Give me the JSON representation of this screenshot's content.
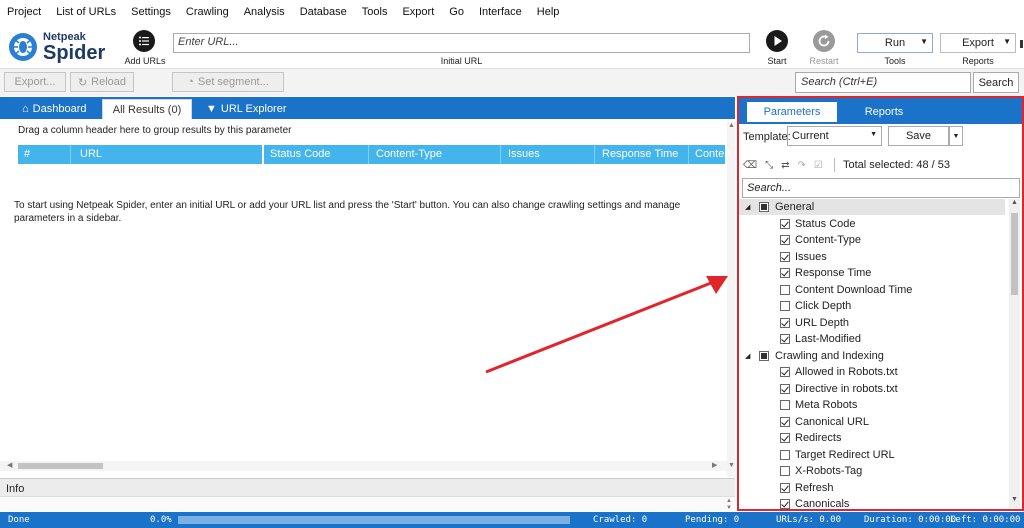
{
  "menu": [
    "Project",
    "List of URLs",
    "Settings",
    "Crawling",
    "Analysis",
    "Database",
    "Tools",
    "Export",
    "Go",
    "Interface",
    "Help"
  ],
  "logo": {
    "line1": "Netpeak",
    "line2": "Spider"
  },
  "toolbar": {
    "add_urls_label": "Add URLs",
    "url_placeholder": "Enter URL...",
    "initial_url_label": "Initial URL",
    "start_label": "Start",
    "restart_label": "Restart",
    "run_label": "Run",
    "tools_label": "Tools",
    "export_label": "Export",
    "reports_label": "Reports"
  },
  "secondrow": {
    "export_label": "Export...",
    "reload_label": "Reload",
    "segment_label": "Set segment...",
    "search_placeholder": "Search (Ctrl+E)",
    "search_button": "Search"
  },
  "tabs": {
    "dashboard": "Dashboard",
    "all_results": "All Results (0)",
    "url_explorer": "URL Explorer"
  },
  "grid": {
    "group_hint": "Drag a column header here to group results by this parameter",
    "columns": [
      "#",
      "URL",
      "Status Code",
      "Content-Type",
      "Issues",
      "Response Time",
      "Conten"
    ],
    "empty_message": "To start using Netpeak Spider, enter an initial URL or add your URL list and press the 'Start' button. You can also change crawling settings and manage parameters in a sidebar."
  },
  "info_label": "Info",
  "panel": {
    "tab_parameters": "Parameters",
    "tab_reports": "Reports",
    "template_label": "Template:",
    "template_value": "Current",
    "save_label": "Save",
    "total_selected": "Total selected: 48 / 53",
    "search_placeholder": "Search...",
    "groups": [
      {
        "name": "General",
        "items": [
          {
            "label": "Status Code",
            "checked": true
          },
          {
            "label": "Content-Type",
            "checked": true
          },
          {
            "label": "Issues",
            "checked": true
          },
          {
            "label": "Response Time",
            "checked": true
          },
          {
            "label": "Content Download Time",
            "checked": false
          },
          {
            "label": "Click Depth",
            "checked": false
          },
          {
            "label": "URL Depth",
            "checked": true
          },
          {
            "label": "Last-Modified",
            "checked": true
          }
        ]
      },
      {
        "name": "Crawling and Indexing",
        "items": [
          {
            "label": "Allowed in Robots.txt",
            "checked": true
          },
          {
            "label": "Directive in robots.txt",
            "checked": true
          },
          {
            "label": "Meta Robots",
            "checked": false
          },
          {
            "label": "Canonical URL",
            "checked": true
          },
          {
            "label": "Redirects",
            "checked": true
          },
          {
            "label": "Target Redirect URL",
            "checked": false
          },
          {
            "label": "X-Robots-Tag",
            "checked": false
          },
          {
            "label": "Refresh",
            "checked": true
          },
          {
            "label": "Canonicals",
            "checked": true
          }
        ]
      }
    ]
  },
  "status": {
    "state": "Done",
    "progress": "0.0%",
    "crawled": "Crawled: 0",
    "pending": "Pending: 0",
    "urls_per_sec": "URLs/s: 0.00",
    "duration": "Duration: 0:00:00",
    "left": "Left: 0:00:00"
  },
  "colors": {
    "accent": "#1a73c8",
    "grid_header": "#44b4ec",
    "highlight": "#e2252b"
  }
}
